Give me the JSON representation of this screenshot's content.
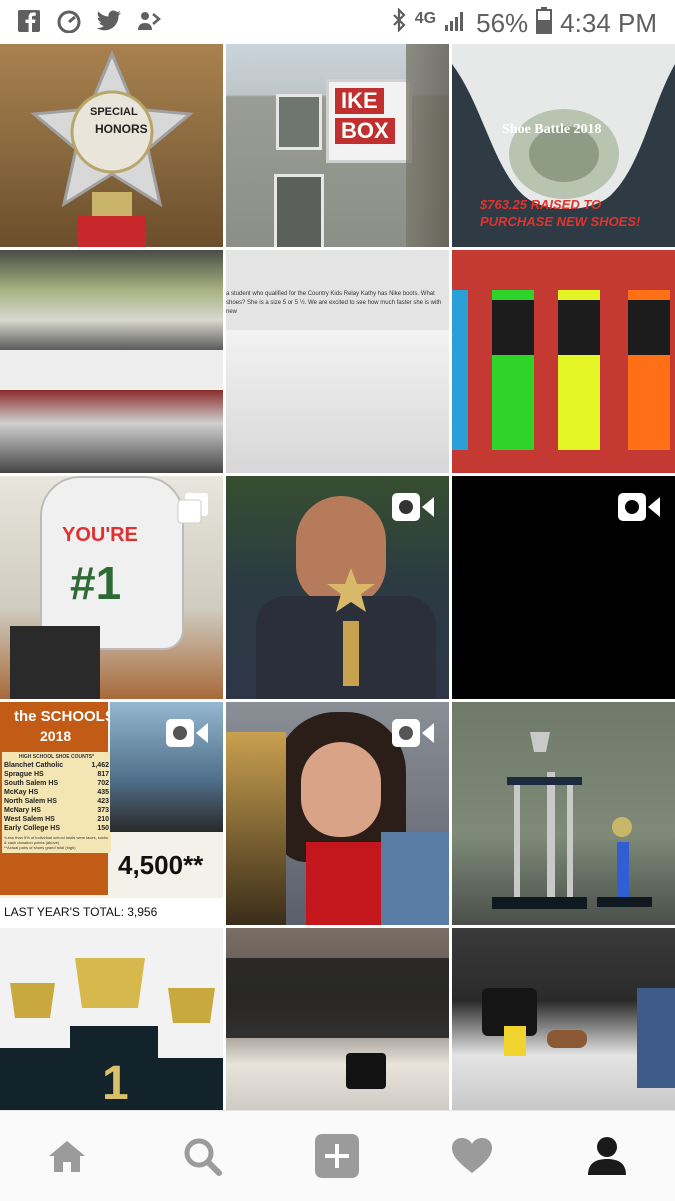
{
  "status_bar": {
    "battery": "56%",
    "time": "4:34 PM",
    "network": "4G"
  },
  "tiles": {
    "t1": {
      "label_1": "SPECIAL",
      "label_2": "HONORS"
    },
    "t2": {
      "sign_1": "IKE",
      "sign_2": "BOX"
    },
    "t3": {
      "title": "Shoe Battle 2018",
      "subtitle": "$763.25 RAISED TO PURCHASE NEW SHOES!"
    },
    "t5": {
      "text": "a student who qualified for the Country Kids Relay Kathy has Nike boots. What shoes? She is a size 5 or 5 ½. We are excited to see how much faster she is with new"
    },
    "t7": {
      "balloon_1": "YOU'RE",
      "balloon_2": "#1"
    },
    "t10": {
      "title_1": "the SCHOOLS",
      "title_2": "2018",
      "table_header": "HIGH SCHOOL SHOE COUNTS*",
      "rows": [
        {
          "school": "Blanchet Catholic",
          "count": "1,462"
        },
        {
          "school": "Sprague HS",
          "count": "817"
        },
        {
          "school": "South Salem HS",
          "count": "702"
        },
        {
          "school": "McKay HS",
          "count": "435"
        },
        {
          "school": "North Salem HS",
          "count": "423"
        },
        {
          "school": "McNary HS",
          "count": "373"
        },
        {
          "school": "West Salem HS",
          "count": "210"
        },
        {
          "school": "Early College HS",
          "count": "150"
        }
      ],
      "footnote": "*Less than 5% of individual school totals were laces, socks & cash donation points (above)",
      "footnote_2": "**Actual pairs of shoes grand total (high)",
      "total": "4,500**",
      "last_year": "LAST YEAR'S TOTAL: 3,956"
    },
    "t13": {
      "podium": "1"
    }
  },
  "colors": {
    "accent_red": "#e0342f",
    "icon_gray": "#9b9b9b",
    "status_gray": "#5f5f5f"
  }
}
